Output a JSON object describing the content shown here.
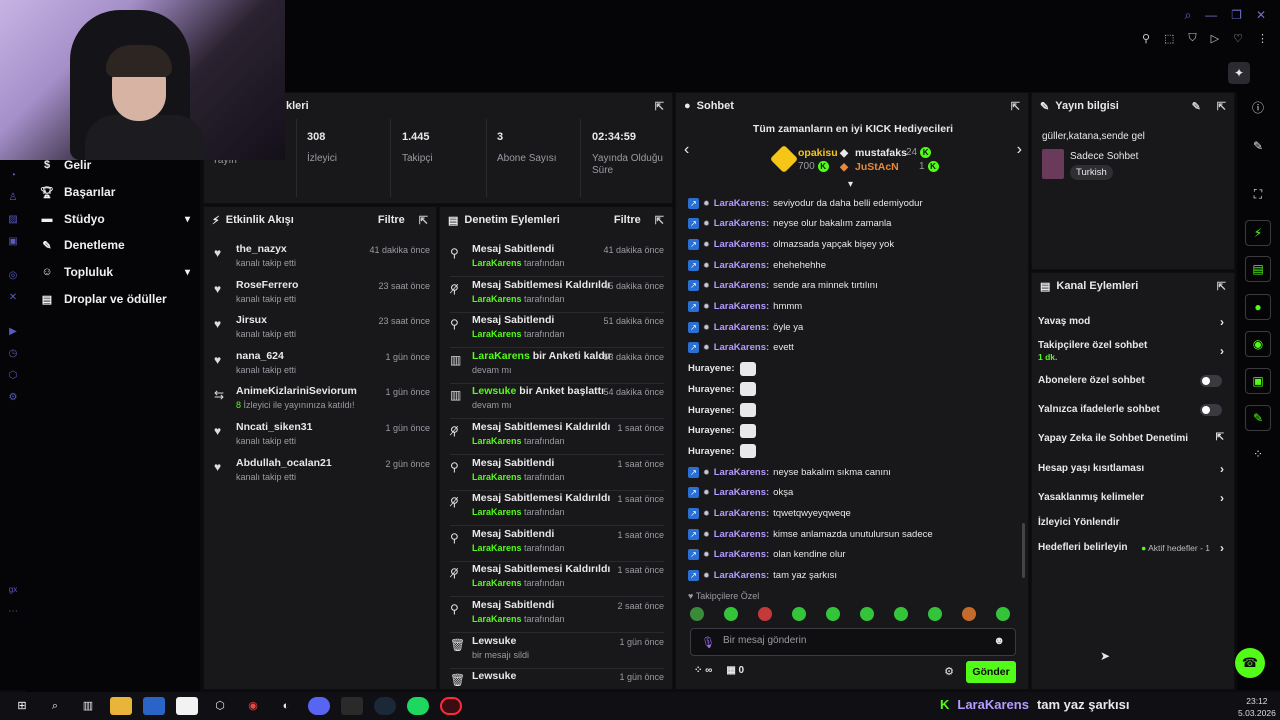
{
  "stats": {
    "partial_title": "kleri",
    "partial_label": "Yayın",
    "items": [
      {
        "value": "308",
        "label": "İzleyici"
      },
      {
        "value": "1.445",
        "label": "Takipçi"
      },
      {
        "value": "3",
        "label": "Abone Sayısı"
      },
      {
        "value": "02:34:59",
        "label": "Yayında Olduğu Süre"
      }
    ]
  },
  "sidebar": {
    "items": [
      {
        "label": "Gelir",
        "icon": "coin-icon"
      },
      {
        "label": "Başarılar",
        "icon": "trophy-icon"
      },
      {
        "label": "Stüdyo",
        "icon": "studio-icon"
      },
      {
        "label": "Denetleme",
        "icon": "wrench-icon"
      },
      {
        "label": "Topluluk",
        "icon": "people-icon"
      },
      {
        "label": "Droplar ve ödüller",
        "icon": "gift-icon"
      }
    ],
    "footer": "gx"
  },
  "activity": {
    "title": "Etkinlik Akışı",
    "filter": "Filtre",
    "items": [
      {
        "name": "the_nazyx",
        "time": "41 dakika önce",
        "sub": "kanalı takip etti",
        "icon": "heart-icon"
      },
      {
        "name": "RoseFerrero",
        "time": "23 saat önce",
        "sub": "kanalı takip etti",
        "icon": "heart-icon"
      },
      {
        "name": "Jirsux",
        "time": "23 saat önce",
        "sub": "kanalı takip etti",
        "icon": "heart-icon"
      },
      {
        "name": "nana_624",
        "time": "1 gün önce",
        "sub": "kanalı takip etti",
        "icon": "heart-icon"
      },
      {
        "name": "AnimeKizlariniSeviorum",
        "time": "1 gün önce",
        "sub_highlight": "8",
        "sub": " İzleyici ile yayınınıza katıldı!",
        "icon": "raid-icon"
      },
      {
        "name": "Nncati_siken31",
        "time": "1 gün önce",
        "sub": "kanalı takip etti",
        "icon": "heart-icon"
      },
      {
        "name": "Abdullah_ocalan21",
        "time": "2 gün önce",
        "sub": "kanalı takip etti",
        "icon": "heart-icon"
      }
    ]
  },
  "moderation": {
    "title": "Denetim Eylemleri",
    "filter": "Filtre",
    "items": [
      {
        "title": "Mesaj Sabitlendi",
        "green": "",
        "time": "41 dakika önce",
        "sub_user": "LaraKarens",
        "sub": " tarafından",
        "icon": "pin-icon"
      },
      {
        "title": "Mesaj Sabitlemesi Kaldırıldı",
        "green": "",
        "time": "45 dakika önce",
        "sub_user": "LaraKarens",
        "sub": " tarafından",
        "icon": "unpin-icon"
      },
      {
        "title": "Mesaj Sabitlendi",
        "green": "",
        "time": "51 dakika önce",
        "sub_user": "LaraKarens",
        "sub": " tarafından",
        "icon": "pin-icon"
      },
      {
        "title": " bir Anketi kaldırdı",
        "green": "LaraKarens",
        "time": "53 dakika önce",
        "sub_user": "",
        "sub": "devam mı",
        "icon": "poll-icon"
      },
      {
        "title": " bir Anket başlattı",
        "green": "Lewsuke",
        "time": "54 dakika önce",
        "sub_user": "",
        "sub": "devam mı",
        "icon": "poll-icon"
      },
      {
        "title": "Mesaj Sabitlemesi Kaldırıldı",
        "green": "",
        "time": "1 saat önce",
        "sub_user": "LaraKarens",
        "sub": " tarafından",
        "icon": "unpin-icon"
      },
      {
        "title": "Mesaj Sabitlendi",
        "green": "",
        "time": "1 saat önce",
        "sub_user": "LaraKarens",
        "sub": " tarafından",
        "icon": "pin-icon"
      },
      {
        "title": "Mesaj Sabitlemesi Kaldırıldı",
        "green": "",
        "time": "1 saat önce",
        "sub_user": "LaraKarens",
        "sub": " tarafından",
        "icon": "unpin-icon"
      },
      {
        "title": "Mesaj Sabitlendi",
        "green": "",
        "time": "1 saat önce",
        "sub_user": "LaraKarens",
        "sub": " tarafından",
        "icon": "pin-icon"
      },
      {
        "title": "Mesaj Sabitlemesi Kaldırıldı",
        "green": "",
        "time": "1 saat önce",
        "sub_user": "LaraKarens",
        "sub": " tarafından",
        "icon": "unpin-icon"
      },
      {
        "title": "Mesaj Sabitlendi",
        "green": "",
        "time": "2 saat önce",
        "sub_user": "LaraKarens",
        "sub": " tarafından",
        "icon": "pin-icon"
      },
      {
        "title": "Lewsuke",
        "green": "",
        "time": "1 gün önce",
        "sub_user": "",
        "sub": "bir mesajı sildi",
        "icon": "trash-icon"
      },
      {
        "title": "Lewsuke",
        "green": "",
        "time": "1 gün önce",
        "sub_user": "",
        "sub": "",
        "icon": "trash-icon"
      }
    ]
  },
  "chat": {
    "title": "Sohbet",
    "gifters_title": "Tüm zamanların en iyi KICK Hediyecileri",
    "gifters": [
      {
        "name": "opakisu",
        "count": "700"
      },
      {
        "name": "mustafaks",
        "count": "24"
      },
      {
        "name": "JuStAcN",
        "count": "1"
      }
    ],
    "messages": [
      {
        "user": "LaraKarens",
        "text": "seviyodur da daha belli edemiyodur",
        "badges": true
      },
      {
        "user": "LaraKarens",
        "text": "neyse olur bakalım zamanla",
        "badges": true
      },
      {
        "user": "LaraKarens",
        "text": "olmazsada yapçak bişey yok",
        "badges": true
      },
      {
        "user": "LaraKarens",
        "text": "ehehehehhe",
        "badges": true
      },
      {
        "user": "LaraKarens",
        "text": "sende ara minnek tırtılını",
        "badges": true
      },
      {
        "user": "LaraKarens",
        "text": "hmmm",
        "badges": true
      },
      {
        "user": "LaraKarens",
        "text": "öyle ya",
        "badges": true
      },
      {
        "user": "LaraKarens",
        "text": "evett",
        "badges": true
      },
      {
        "user": "Hurayene",
        "text": "",
        "badges": false
      },
      {
        "user": "Hurayene",
        "text": "",
        "badges": false
      },
      {
        "user": "Hurayene",
        "text": "",
        "badges": false
      },
      {
        "user": "Hurayene",
        "text": "",
        "badges": false
      },
      {
        "user": "Hurayene",
        "text": "",
        "badges": false
      },
      {
        "user": "LaraKarens",
        "text": "neyse bakalım sıkma canını",
        "badges": true
      },
      {
        "user": "LaraKarens",
        "text": "okşa",
        "badges": true
      },
      {
        "user": "LaraKarens",
        "text": "tqwetqwyeyqweqe",
        "badges": true
      },
      {
        "user": "LaraKarens",
        "text": "kimse anlamazda unutulursun sadece",
        "badges": true
      },
      {
        "user": "LaraKarens",
        "text": "olan kendine olur",
        "badges": true
      },
      {
        "user": "LaraKarens",
        "text": "tam yaz şarkısı",
        "badges": true
      }
    ],
    "followers_only": "Takipçilere Özel",
    "placeholder": "Bir mesaj gönderin",
    "infinity": "∞",
    "gift_count": "0",
    "send": "Gönder"
  },
  "stream_info": {
    "title": "Yayın bilgisi",
    "stream_title": "güller,katana,sende gel",
    "category": "Sadece Sohbet",
    "tag": "Turkish"
  },
  "channel_actions": {
    "title": "Kanal Eylemleri",
    "items": [
      {
        "label": "Yavaş mod",
        "control": "chevron"
      },
      {
        "label": "Takipçilere özel sohbet",
        "sub": "1 dk.",
        "control": "chevron"
      },
      {
        "label": "Abonelere özel sohbet",
        "control": "toggle"
      },
      {
        "label": "Yalnızca ifadelerle sohbet",
        "control": "toggle"
      },
      {
        "label": "Yapay Zeka ile Sohbet Denetimi",
        "control": "external"
      },
      {
        "label": "Hesap yaşı kısıtlaması",
        "control": "chevron"
      },
      {
        "label": "Yasaklanmış kelimeler",
        "control": "chevron"
      },
      {
        "label": "İzleyici Yönlendir",
        "control": "none"
      },
      {
        "label": "Hedefleri belirleyin",
        "control": "chevron",
        "right_text": "Aktif hedefler - 1"
      }
    ]
  },
  "overlay": {
    "user": "LaraKarens",
    "text": "tam yaz şarkısı"
  },
  "clock": {
    "time": "23:12",
    "date": "5.03.2026"
  },
  "colors": {
    "accent": "#53fc18",
    "username": "#b49bff",
    "panel": "#18181b"
  }
}
